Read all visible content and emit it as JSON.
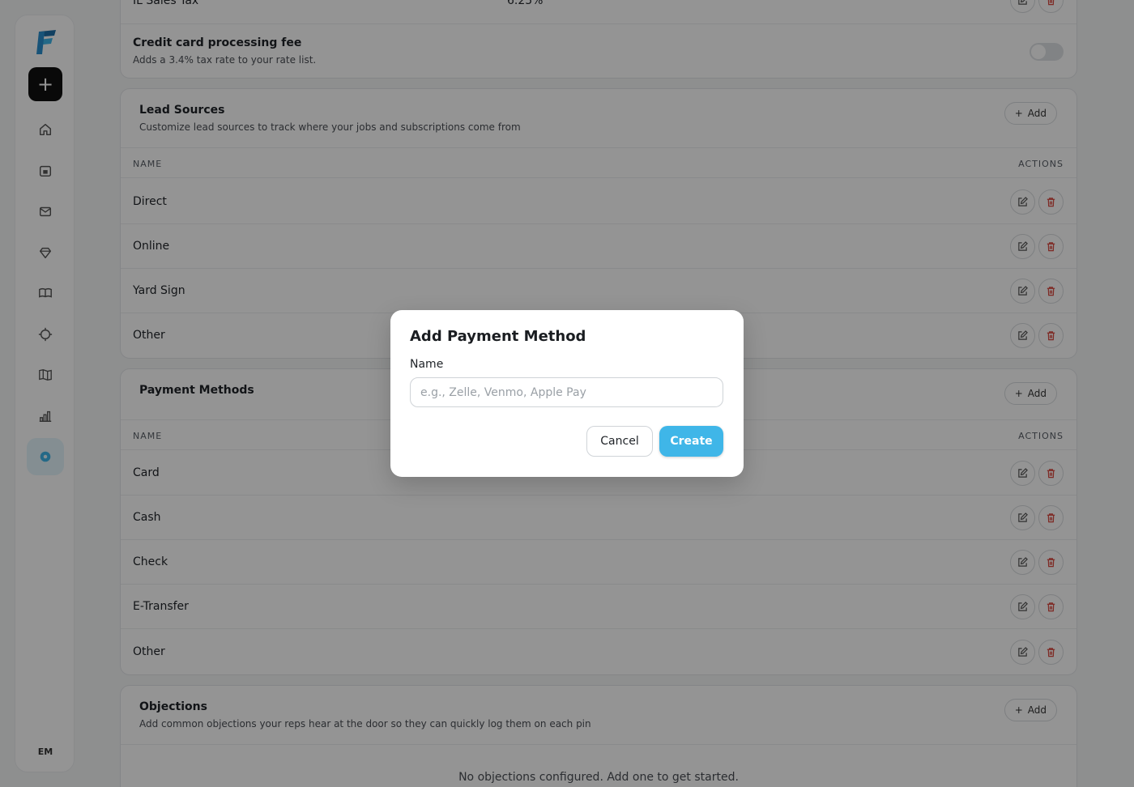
{
  "sidebar": {
    "new_label": "+",
    "avatar_initials": "EM",
    "icons": [
      "home-icon",
      "calendar-icon",
      "mail-icon",
      "diamond-icon",
      "book-icon",
      "target-icon",
      "map-icon",
      "chart-icon",
      "settings-icon"
    ]
  },
  "tax": {
    "partial_name": "IL Sales Tax",
    "partial_rate": "6.25%",
    "fee_title": "Credit card processing fee",
    "fee_desc": "Adds a 3.4% tax rate to your rate list.",
    "fee_enabled": false
  },
  "lead_sources": {
    "title": "Lead Sources",
    "subtitle": "Customize lead sources to track where your jobs and subscriptions come from",
    "add_label": "Add",
    "col_name": "NAME",
    "col_actions": "ACTIONS",
    "rows": [
      "Direct",
      "Online",
      "Yard Sign",
      "Other"
    ]
  },
  "payment_methods": {
    "title": "Payment Methods",
    "add_label": "Add",
    "col_name": "NAME",
    "col_actions": "ACTIONS",
    "rows": [
      "Card",
      "Cash",
      "Check",
      "E-Transfer",
      "Other"
    ]
  },
  "objections": {
    "title": "Objections",
    "subtitle": "Add common objections your reps hear at the door so they can quickly log them on each pin",
    "add_label": "Add",
    "empty_text": "No objections configured. Add one to get started."
  },
  "modal": {
    "title": "Add Payment Method",
    "name_label": "Name",
    "name_value": "",
    "name_placeholder": "e.g., Zelle, Venmo, Apple Pay",
    "cancel_label": "Cancel",
    "create_label": "Create"
  },
  "colors": {
    "accent": "#3fb6e8",
    "delete": "#d9453c"
  }
}
